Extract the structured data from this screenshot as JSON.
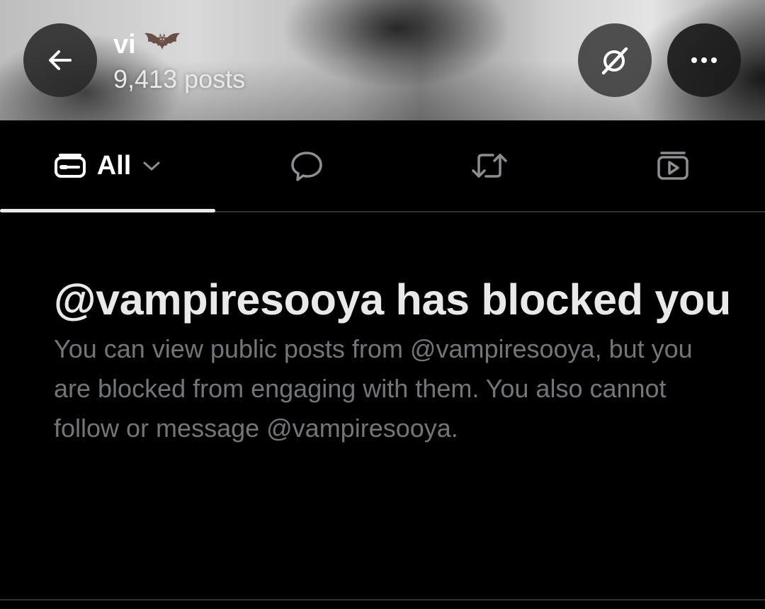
{
  "header": {
    "profile_name": "vi",
    "profile_emoji": "bat-emoji",
    "post_count": "9,413 posts",
    "back_icon": "arrow-left-icon",
    "grok_icon": "grok-icon",
    "more_icon": "more-horizontal-icon"
  },
  "tabs": {
    "all_label": "All",
    "items": [
      {
        "id": "all",
        "icon": "timeline-icon",
        "selected": true
      },
      {
        "id": "replies",
        "icon": "reply-bubble-icon",
        "selected": false
      },
      {
        "id": "reposts",
        "icon": "repost-icon",
        "selected": false
      },
      {
        "id": "media",
        "icon": "media-play-icon",
        "selected": false
      }
    ]
  },
  "block_notice": {
    "title": "@vampiresooya has blocked you",
    "body": "You can view public posts from @vampiresooya, but you are blocked from engaging with them. You also cannot follow or message @vampiresooya."
  },
  "colors": {
    "background": "#000000",
    "primary_text": "#e7e9ea",
    "secondary_text": "#71767b",
    "divider": "#2f3336",
    "button_bg": "#282828"
  }
}
